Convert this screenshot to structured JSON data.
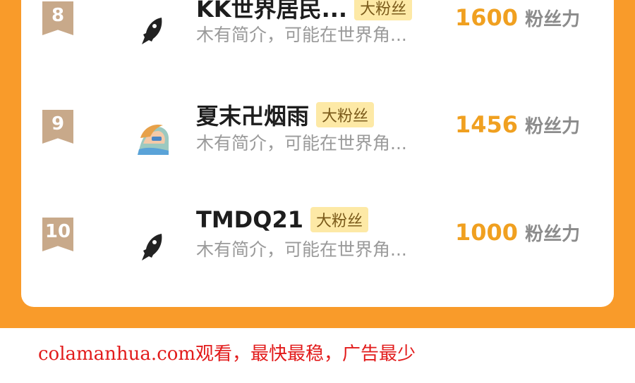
{
  "ranking": {
    "rows": [
      {
        "rank": "8",
        "name": "KK世界居民...",
        "badge": "大粉丝",
        "intro": "木有简介，可能在世界角...",
        "score": "1600",
        "unit": "粉丝力",
        "avatar_icon": "rocket-icon"
      },
      {
        "rank": "9",
        "name": "夏末卍烟雨",
        "badge": "大粉丝",
        "intro": "木有简介，可能在世界角...",
        "score": "1456",
        "unit": "粉丝力",
        "avatar_icon": "anime-avatar-image"
      },
      {
        "rank": "10",
        "name": "TMDQ21",
        "badge": "大粉丝",
        "intro": "木有简介，可能在世界角...",
        "score": "1000",
        "unit": "粉丝力",
        "avatar_icon": "rocket-icon"
      }
    ]
  },
  "footer": {
    "text": "colamanhua.com观看，最快最稳，广告最少"
  },
  "colors": {
    "accent": "#f99b2a",
    "score": "#f0a020",
    "badge_bg": "#fde9a6",
    "rank_bg": "#c8a98a",
    "footer_text": "#e21b1b"
  }
}
